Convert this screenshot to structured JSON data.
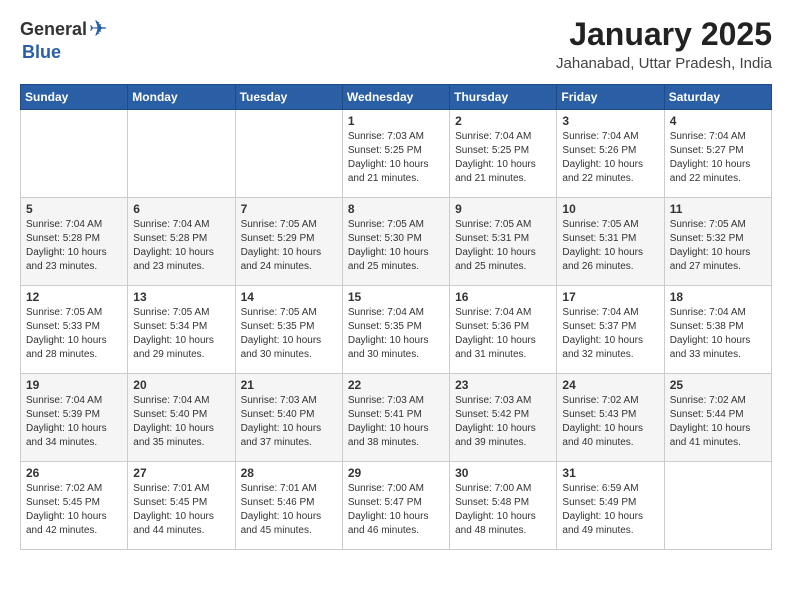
{
  "header": {
    "logo_general": "General",
    "logo_blue": "Blue",
    "month": "January 2025",
    "location": "Jahanabad, Uttar Pradesh, India"
  },
  "weekdays": [
    "Sunday",
    "Monday",
    "Tuesday",
    "Wednesday",
    "Thursday",
    "Friday",
    "Saturday"
  ],
  "weeks": [
    [
      {
        "day": "",
        "info": ""
      },
      {
        "day": "",
        "info": ""
      },
      {
        "day": "",
        "info": ""
      },
      {
        "day": "1",
        "info": "Sunrise: 7:03 AM\nSunset: 5:25 PM\nDaylight: 10 hours\nand 21 minutes."
      },
      {
        "day": "2",
        "info": "Sunrise: 7:04 AM\nSunset: 5:25 PM\nDaylight: 10 hours\nand 21 minutes."
      },
      {
        "day": "3",
        "info": "Sunrise: 7:04 AM\nSunset: 5:26 PM\nDaylight: 10 hours\nand 22 minutes."
      },
      {
        "day": "4",
        "info": "Sunrise: 7:04 AM\nSunset: 5:27 PM\nDaylight: 10 hours\nand 22 minutes."
      }
    ],
    [
      {
        "day": "5",
        "info": "Sunrise: 7:04 AM\nSunset: 5:28 PM\nDaylight: 10 hours\nand 23 minutes."
      },
      {
        "day": "6",
        "info": "Sunrise: 7:04 AM\nSunset: 5:28 PM\nDaylight: 10 hours\nand 23 minutes."
      },
      {
        "day": "7",
        "info": "Sunrise: 7:05 AM\nSunset: 5:29 PM\nDaylight: 10 hours\nand 24 minutes."
      },
      {
        "day": "8",
        "info": "Sunrise: 7:05 AM\nSunset: 5:30 PM\nDaylight: 10 hours\nand 25 minutes."
      },
      {
        "day": "9",
        "info": "Sunrise: 7:05 AM\nSunset: 5:31 PM\nDaylight: 10 hours\nand 25 minutes."
      },
      {
        "day": "10",
        "info": "Sunrise: 7:05 AM\nSunset: 5:31 PM\nDaylight: 10 hours\nand 26 minutes."
      },
      {
        "day": "11",
        "info": "Sunrise: 7:05 AM\nSunset: 5:32 PM\nDaylight: 10 hours\nand 27 minutes."
      }
    ],
    [
      {
        "day": "12",
        "info": "Sunrise: 7:05 AM\nSunset: 5:33 PM\nDaylight: 10 hours\nand 28 minutes."
      },
      {
        "day": "13",
        "info": "Sunrise: 7:05 AM\nSunset: 5:34 PM\nDaylight: 10 hours\nand 29 minutes."
      },
      {
        "day": "14",
        "info": "Sunrise: 7:05 AM\nSunset: 5:35 PM\nDaylight: 10 hours\nand 30 minutes."
      },
      {
        "day": "15",
        "info": "Sunrise: 7:04 AM\nSunset: 5:35 PM\nDaylight: 10 hours\nand 30 minutes."
      },
      {
        "day": "16",
        "info": "Sunrise: 7:04 AM\nSunset: 5:36 PM\nDaylight: 10 hours\nand 31 minutes."
      },
      {
        "day": "17",
        "info": "Sunrise: 7:04 AM\nSunset: 5:37 PM\nDaylight: 10 hours\nand 32 minutes."
      },
      {
        "day": "18",
        "info": "Sunrise: 7:04 AM\nSunset: 5:38 PM\nDaylight: 10 hours\nand 33 minutes."
      }
    ],
    [
      {
        "day": "19",
        "info": "Sunrise: 7:04 AM\nSunset: 5:39 PM\nDaylight: 10 hours\nand 34 minutes."
      },
      {
        "day": "20",
        "info": "Sunrise: 7:04 AM\nSunset: 5:40 PM\nDaylight: 10 hours\nand 35 minutes."
      },
      {
        "day": "21",
        "info": "Sunrise: 7:03 AM\nSunset: 5:40 PM\nDaylight: 10 hours\nand 37 minutes."
      },
      {
        "day": "22",
        "info": "Sunrise: 7:03 AM\nSunset: 5:41 PM\nDaylight: 10 hours\nand 38 minutes."
      },
      {
        "day": "23",
        "info": "Sunrise: 7:03 AM\nSunset: 5:42 PM\nDaylight: 10 hours\nand 39 minutes."
      },
      {
        "day": "24",
        "info": "Sunrise: 7:02 AM\nSunset: 5:43 PM\nDaylight: 10 hours\nand 40 minutes."
      },
      {
        "day": "25",
        "info": "Sunrise: 7:02 AM\nSunset: 5:44 PM\nDaylight: 10 hours\nand 41 minutes."
      }
    ],
    [
      {
        "day": "26",
        "info": "Sunrise: 7:02 AM\nSunset: 5:45 PM\nDaylight: 10 hours\nand 42 minutes."
      },
      {
        "day": "27",
        "info": "Sunrise: 7:01 AM\nSunset: 5:45 PM\nDaylight: 10 hours\nand 44 minutes."
      },
      {
        "day": "28",
        "info": "Sunrise: 7:01 AM\nSunset: 5:46 PM\nDaylight: 10 hours\nand 45 minutes."
      },
      {
        "day": "29",
        "info": "Sunrise: 7:00 AM\nSunset: 5:47 PM\nDaylight: 10 hours\nand 46 minutes."
      },
      {
        "day": "30",
        "info": "Sunrise: 7:00 AM\nSunset: 5:48 PM\nDaylight: 10 hours\nand 48 minutes."
      },
      {
        "day": "31",
        "info": "Sunrise: 6:59 AM\nSunset: 5:49 PM\nDaylight: 10 hours\nand 49 minutes."
      },
      {
        "day": "",
        "info": ""
      }
    ]
  ]
}
